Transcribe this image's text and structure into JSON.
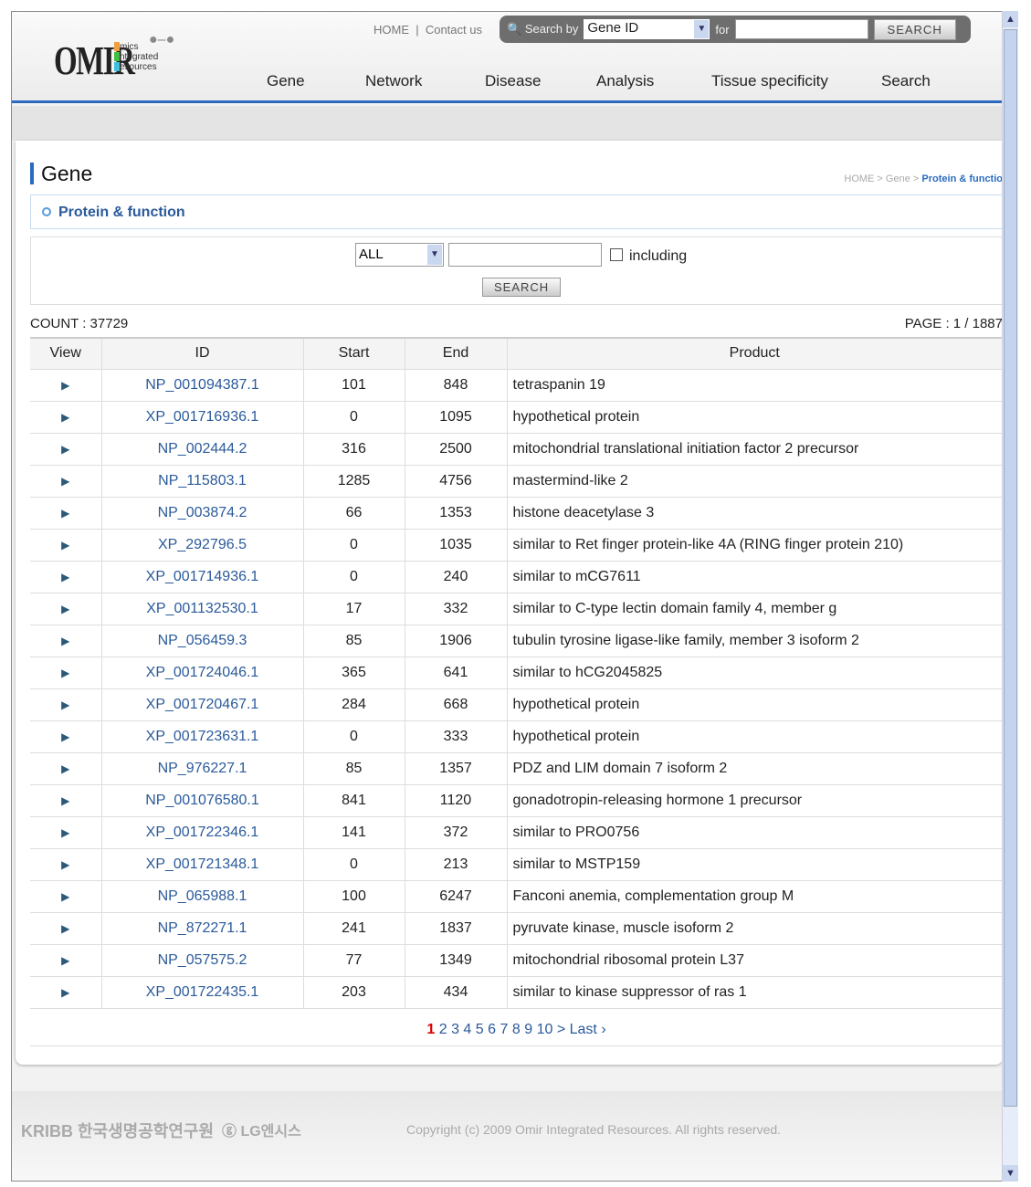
{
  "header": {
    "logo": "OMIR",
    "logo_sub": [
      "mics",
      "ntegrated",
      "esources"
    ],
    "links": [
      "HOME",
      "Contact us"
    ],
    "search": {
      "label": "Search by",
      "field": "Gene ID",
      "for_label": "for",
      "value": "",
      "button": "SEARCH"
    },
    "nav": [
      "Gene",
      "Network",
      "Disease",
      "Analysis",
      "Tissue specificity",
      "Search"
    ]
  },
  "page": {
    "title": "Gene",
    "breadcrumb": [
      "HOME",
      "Gene"
    ],
    "breadcrumb_current": "Protein & functio",
    "section": "Protein & function"
  },
  "filter": {
    "select": "ALL",
    "value": "",
    "checkbox_label": "including",
    "checked": false,
    "button": "SEARCH"
  },
  "count": "COUNT : 37729",
  "pageinfo": "PAGE : 1 / 1887",
  "table": {
    "headers": [
      "View",
      "ID",
      "Start",
      "End",
      "Product"
    ],
    "rows": [
      [
        "NP_001094387.1",
        "101",
        "848",
        "tetraspanin 19"
      ],
      [
        "XP_001716936.1",
        "0",
        "1095",
        "hypothetical protein"
      ],
      [
        "NP_002444.2",
        "316",
        "2500",
        "mitochondrial translational initiation factor 2 precursor"
      ],
      [
        "NP_115803.1",
        "1285",
        "4756",
        "mastermind-like 2"
      ],
      [
        "NP_003874.2",
        "66",
        "1353",
        "histone deacetylase 3"
      ],
      [
        "XP_292796.5",
        "0",
        "1035",
        "similar to Ret finger protein-like 4A (RING finger protein 210)"
      ],
      [
        "XP_001714936.1",
        "0",
        "240",
        "similar to mCG7611"
      ],
      [
        "XP_001132530.1",
        "17",
        "332",
        "similar to C-type lectin domain family 4, member g"
      ],
      [
        "NP_056459.3",
        "85",
        "1906",
        "tubulin tyrosine ligase-like family, member 3 isoform 2"
      ],
      [
        "XP_001724046.1",
        "365",
        "641",
        "similar to hCG2045825"
      ],
      [
        "XP_001720467.1",
        "284",
        "668",
        "hypothetical protein"
      ],
      [
        "XP_001723631.1",
        "0",
        "333",
        "hypothetical protein"
      ],
      [
        "NP_976227.1",
        "85",
        "1357",
        "PDZ and LIM domain 7 isoform 2"
      ],
      [
        "NP_001076580.1",
        "841",
        "1120",
        "gonadotropin-releasing hormone 1 precursor"
      ],
      [
        "XP_001722346.1",
        "141",
        "372",
        "similar to PRO0756"
      ],
      [
        "XP_001721348.1",
        "0",
        "213",
        "similar to MSTP159"
      ],
      [
        "NP_065988.1",
        "100",
        "6247",
        "Fanconi anemia, complementation group M"
      ],
      [
        "NP_872271.1",
        "241",
        "1837",
        "pyruvate kinase, muscle isoform 2"
      ],
      [
        "NP_057575.2",
        "77",
        "1349",
        "mitochondrial ribosomal protein L37"
      ],
      [
        "XP_001722435.1",
        "203",
        "434",
        "similar to kinase suppressor of ras 1"
      ]
    ]
  },
  "pager": {
    "current": "1",
    "pages": [
      "2",
      "3",
      "4",
      "5",
      "6",
      "7",
      "8",
      "9",
      "10"
    ],
    "next": ">",
    "last": "Last ›"
  },
  "footer": {
    "kribb": "KRIBB 한국생명공학연구원",
    "lg": "LG엔시스",
    "copyright": "Copyright (c) 2009 Omir Integrated Resources. All rights reserved."
  },
  "colors": {
    "accent": "#2a6bbf",
    "link": "#2a5a9a",
    "current_page": "#dd0000"
  }
}
